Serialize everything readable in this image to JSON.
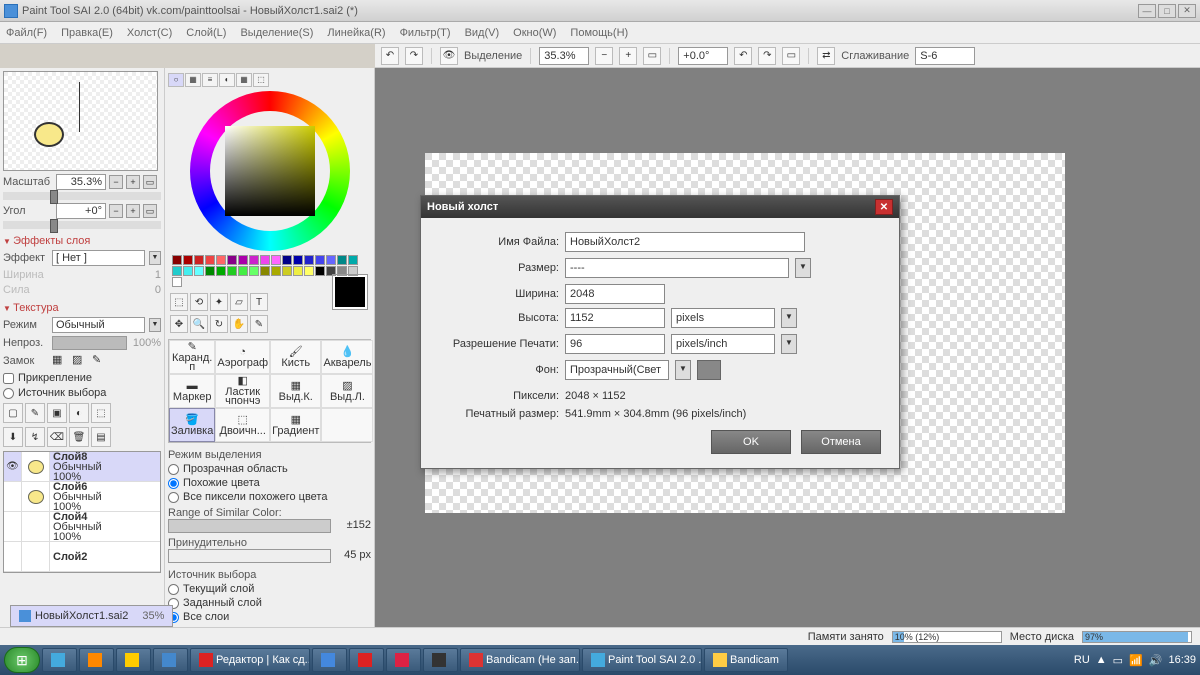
{
  "title": "Paint Tool SAI 2.0 (64bit) vk.com/painttoolsai - НовыйХолст1.sai2 (*)",
  "menu": {
    "file": "Файл(F)",
    "edit": "Правка(E)",
    "canvas": "Холст(C)",
    "layer": "Слой(L)",
    "select": "Выделение(S)",
    "ruler": "Линейка(R)",
    "filter": "Фильтр(T)",
    "view": "Вид(V)",
    "window": "Окно(W)",
    "help": "Помощь(H)"
  },
  "toolbar": {
    "selection": "Выделение",
    "zoom": "35.3%",
    "angle": "+0.0°",
    "smoothing_lbl": "Сглаживание",
    "smoothing": "S-6"
  },
  "nav": {
    "scale_lbl": "Масштаб",
    "scale": "35.3%",
    "angle_lbl": "Угол",
    "angle": "+0°"
  },
  "fx": {
    "header": "Эффекты слоя",
    "effect_lbl": "Эффект",
    "effect": "[ Нет ]",
    "width_lbl": "Ширина",
    "width": "1",
    "strength_lbl": "Сила",
    "strength": "0"
  },
  "tex": {
    "header": "Текстура",
    "mode_lbl": "Режим",
    "mode": "Обычный",
    "opacity_lbl": "Непроз.",
    "opacity": "100%",
    "lock_lbl": "Замок",
    "pin": "Прикрепление",
    "clipsrc": "Источник выбора"
  },
  "layers": [
    {
      "name": "Слой8",
      "mode": "Обычный",
      "op": "100%",
      "sel": true,
      "vis": true,
      "face": true
    },
    {
      "name": "Слой6",
      "mode": "Обычный",
      "op": "100%",
      "sel": false,
      "vis": false,
      "face": true
    },
    {
      "name": "Слой4",
      "mode": "Обычный",
      "op": "100%",
      "sel": false,
      "vis": false,
      "face": false
    },
    {
      "name": "Слой2",
      "mode": "",
      "op": "",
      "sel": false,
      "vis": false,
      "face": false
    }
  ],
  "brushes": [
    {
      "n": "Каранд. п"
    },
    {
      "n": "Аэрограф"
    },
    {
      "n": "Кисть"
    },
    {
      "n": "Акварель"
    },
    {
      "n": "Маркер"
    },
    {
      "n": "Ластик чпончэ"
    },
    {
      "n": "Выд.К."
    },
    {
      "n": "Выд.Л."
    },
    {
      "n": "Заливка",
      "sel": true
    },
    {
      "n": "Двоичн..."
    },
    {
      "n": "Градиент"
    },
    {
      "n": ""
    }
  ],
  "selmode": {
    "header": "Режим выделения",
    "o1": "Прозрачная область",
    "o2": "Похожие цвета",
    "o3": "Все пиксели похожего цвета"
  },
  "range": {
    "lbl": "Range of Similar Color:",
    "val": "±152"
  },
  "force": {
    "lbl": "Принудительно",
    "val": "45 px"
  },
  "src": {
    "header": "Источник выбора",
    "o1": "Текущий слой",
    "o2": "Заданный слой",
    "o3": "Все слои"
  },
  "dialog": {
    "title": "Новый холст",
    "fname_lbl": "Имя Файла:",
    "fname": "НовыйХолст2",
    "size_lbl": "Размер:",
    "size": "----",
    "width_lbl": "Ширина:",
    "width": "2048",
    "height_lbl": "Высота:",
    "height": "1152",
    "units": "pixels",
    "res_lbl": "Разрешение Печати:",
    "res": "96",
    "res_units": "pixels/inch",
    "bg_lbl": "Фон:",
    "bg": "Прозрачный(Свет",
    "px_lbl": "Пиксели:",
    "px": "2048 × 1152",
    "print_lbl": "Печатный размер:",
    "print": "541.9mm × 304.8mm (96 pixels/inch)",
    "ok": "OK",
    "cancel": "Отмена"
  },
  "doctab": {
    "name": "НовыйХолст1.sai2",
    "zoom": "35%"
  },
  "status": {
    "mem_lbl": "Памяти занято",
    "mem": "10% (12%)",
    "mem_pct": 10,
    "disk_lbl": "Место диска",
    "disk": "97%",
    "disk_pct": 97
  },
  "taskbar": {
    "items": [
      "",
      "",
      "",
      "",
      "Редактор | Как сд...",
      "",
      "",
      "",
      "",
      "Bandicam (Не зап...",
      "Paint Tool SAI 2.0 ...",
      "Bandicam"
    ],
    "lang": "RU",
    "time": "16:39"
  }
}
